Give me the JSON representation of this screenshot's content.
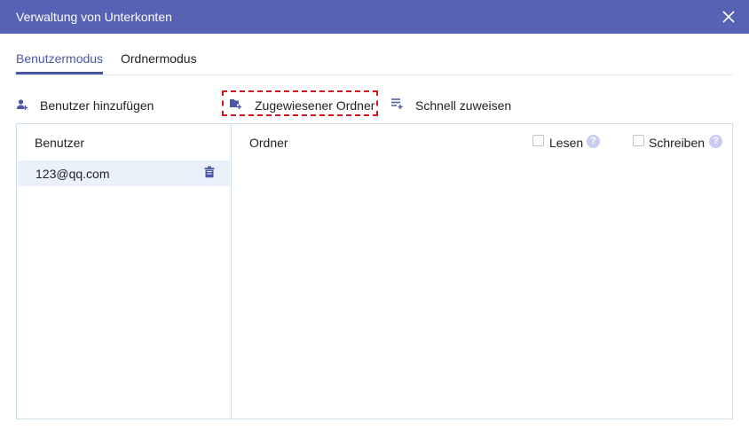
{
  "window": {
    "title": "Verwaltung von Unterkonten",
    "close_icon": "close-icon"
  },
  "tabs": [
    {
      "label": "Benutzermodus",
      "active": true
    },
    {
      "label": "Ordnermodus",
      "active": false
    }
  ],
  "toolbar": {
    "add_user": {
      "label": "Benutzer hinzufügen",
      "icon": "add-user-icon"
    },
    "assigned_folder": {
      "label": "Zugewiesener Ordner",
      "icon": "folder-add-icon"
    },
    "quick_assign": {
      "label": "Schnell zuweisen",
      "icon": "list-add-icon"
    }
  },
  "users_panel": {
    "header": "Benutzer",
    "users": [
      {
        "email": "123@qq.com",
        "selected": true
      }
    ]
  },
  "folders_panel": {
    "header": "Ordner",
    "read": {
      "label": "Lesen",
      "checked": false
    },
    "write": {
      "label": "Schreiben",
      "checked": false
    }
  },
  "colors": {
    "titlebar": "#5762b4",
    "accent": "#4a57a6",
    "highlight_border": "#d0161c",
    "selected_row": "#eaf1fb"
  }
}
